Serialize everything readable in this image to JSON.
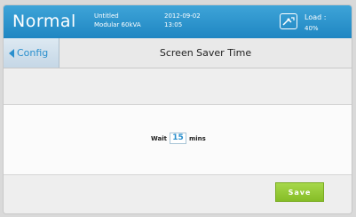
{
  "header": {
    "mode": "Normal",
    "model_line1": "Untitled",
    "model_line2": "Modular 60kVA",
    "date": "2012-09-02",
    "time": "13:05",
    "load_label": "Load :",
    "load_value": "40%",
    "load_icon": "load-gauge-icon"
  },
  "nav": {
    "back_label": "Config",
    "title": "Screen Saver Time"
  },
  "form": {
    "wait_label": "Wait",
    "wait_value": "15",
    "unit_label": "mins"
  },
  "actions": {
    "save_label": "Save"
  },
  "colors": {
    "header_blue": "#2a95cf",
    "accent_blue": "#2a8fcd",
    "save_green": "#94c935"
  }
}
